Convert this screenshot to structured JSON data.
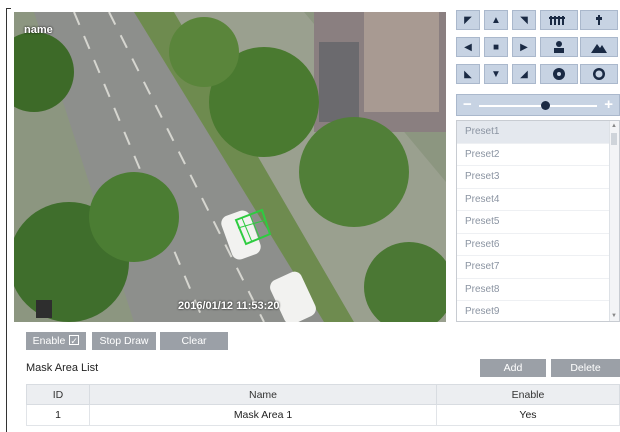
{
  "camera": {
    "name": "name",
    "timestamp": "2016/01/12  11:53:20"
  },
  "ptz": {
    "buttons": [
      {
        "icon": "arrow-up-left-icon",
        "glyph": "◤"
      },
      {
        "icon": "arrow-up-icon",
        "glyph": "▲"
      },
      {
        "icon": "arrow-up-right-icon",
        "glyph": "◥"
      },
      {
        "icon": "arrow-left-icon",
        "glyph": "◀"
      },
      {
        "icon": "stop-icon",
        "glyph": "■"
      },
      {
        "icon": "arrow-right-icon",
        "glyph": "▶"
      },
      {
        "icon": "arrow-down-left-icon",
        "glyph": "◣"
      },
      {
        "icon": "arrow-down-icon",
        "glyph": "▼"
      },
      {
        "icon": "arrow-down-right-icon",
        "glyph": "◢"
      }
    ],
    "zoom_minus": "−",
    "zoom_plus": "+",
    "zoom_level": 0.55
  },
  "presets": [
    "Preset1",
    "Preset2",
    "Preset3",
    "Preset4",
    "Preset5",
    "Preset6",
    "Preset7",
    "Preset8",
    "Preset9"
  ],
  "toolbar": {
    "enable": "Enable",
    "stop_draw": "Stop Draw",
    "clear": "Clear"
  },
  "mask": {
    "title": "Mask Area List",
    "add": "Add",
    "delete": "Delete",
    "columns": [
      "ID",
      "Name",
      "Enable"
    ],
    "rows": [
      {
        "id": "1",
        "name": "Mask Area 1",
        "enable": "Yes"
      }
    ]
  },
  "colors": {
    "button": "#9ba0a7",
    "ptz": "#c7d3e3",
    "mask": "#2ecc40"
  }
}
